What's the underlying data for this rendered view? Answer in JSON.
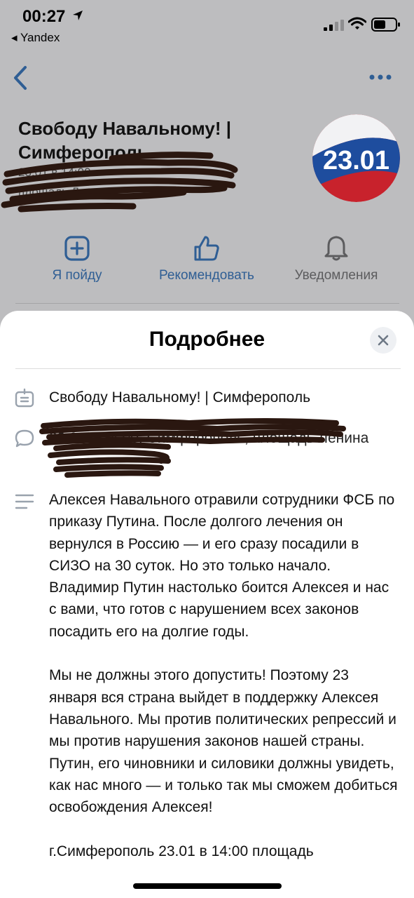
{
  "status_bar": {
    "time": "00:27",
    "back_app": "◂ Yandex"
  },
  "event": {
    "title": "Свободу Навальному! | Симферополь",
    "meta": "23.01 в 14:00",
    "place": "площадь Ленина",
    "avatar_text": "23.01"
  },
  "actions": [
    {
      "label": "Я пойду",
      "icon": "plus-square-icon"
    },
    {
      "label": "Рекомендовать",
      "icon": "thumbs-up-icon"
    },
    {
      "label": "Уведомления",
      "icon": "bell-icon"
    }
  ],
  "sheet": {
    "title": "Подробнее",
    "name": "Свободу Навальному! | Симферополь",
    "place": "23.01 в 14:00, Симферополь, площадь Ленина",
    "description": [
      "Алексея Навального отравили сотрудники ФСБ по приказу Путина. После долгого лечения он вернулся в Россию — и его сразу посадили в СИЗО на 30 суток. Но это только начало. Владимир Путин настолько боится Алексея и нас с вами, что готов с нарушением всех законов посадить его на долгие годы.",
      "Мы не должны этого допустить! Поэтому 23 января вся страна выйдет в поддержку Алексея Навального. Мы против политических репрессий и мы против нарушения законов нашей страны. Путин, его чиновники и силовики должны увидеть, как нас много — и только так мы сможем добиться освобождения Алексея!",
      "г.Симферополь 23.01 в 14:00 площадь"
    ]
  },
  "colors": {
    "accent": "#2f5e94",
    "scrim": "#bdbdbf",
    "scribble": "#2a1710"
  }
}
